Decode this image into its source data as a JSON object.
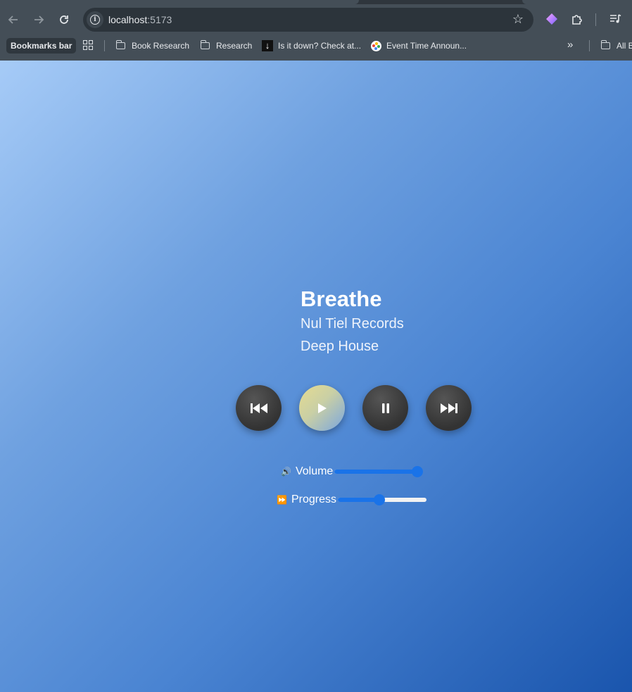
{
  "browser": {
    "url_host": "localhost",
    "url_port": ":5173",
    "bookmarks_label": "Bookmarks bar",
    "bookmarks": [
      {
        "label": "Book Research",
        "icon": "folder-icon"
      },
      {
        "label": "Research",
        "icon": "folder-icon"
      },
      {
        "label": "Is it down? Check at...",
        "icon": "down-arrow-icon"
      },
      {
        "label": "Event Time Announ...",
        "icon": "event-icon"
      }
    ],
    "all_bookmarks_label": "All B"
  },
  "player": {
    "title": "Breathe",
    "label": "Nul Tiel Records",
    "genre": "Deep House",
    "controls": [
      {
        "name": "previous",
        "icon": "skip-back-icon"
      },
      {
        "name": "play",
        "icon": "play-icon"
      },
      {
        "name": "pause",
        "icon": "pause-icon"
      },
      {
        "name": "next",
        "icon": "skip-forward-icon"
      }
    ],
    "volume": {
      "icon": "🔊",
      "label": "Volume",
      "value": 1.0
    },
    "progress": {
      "icon": "⏩",
      "label": "Progress",
      "value": 0.47
    }
  }
}
